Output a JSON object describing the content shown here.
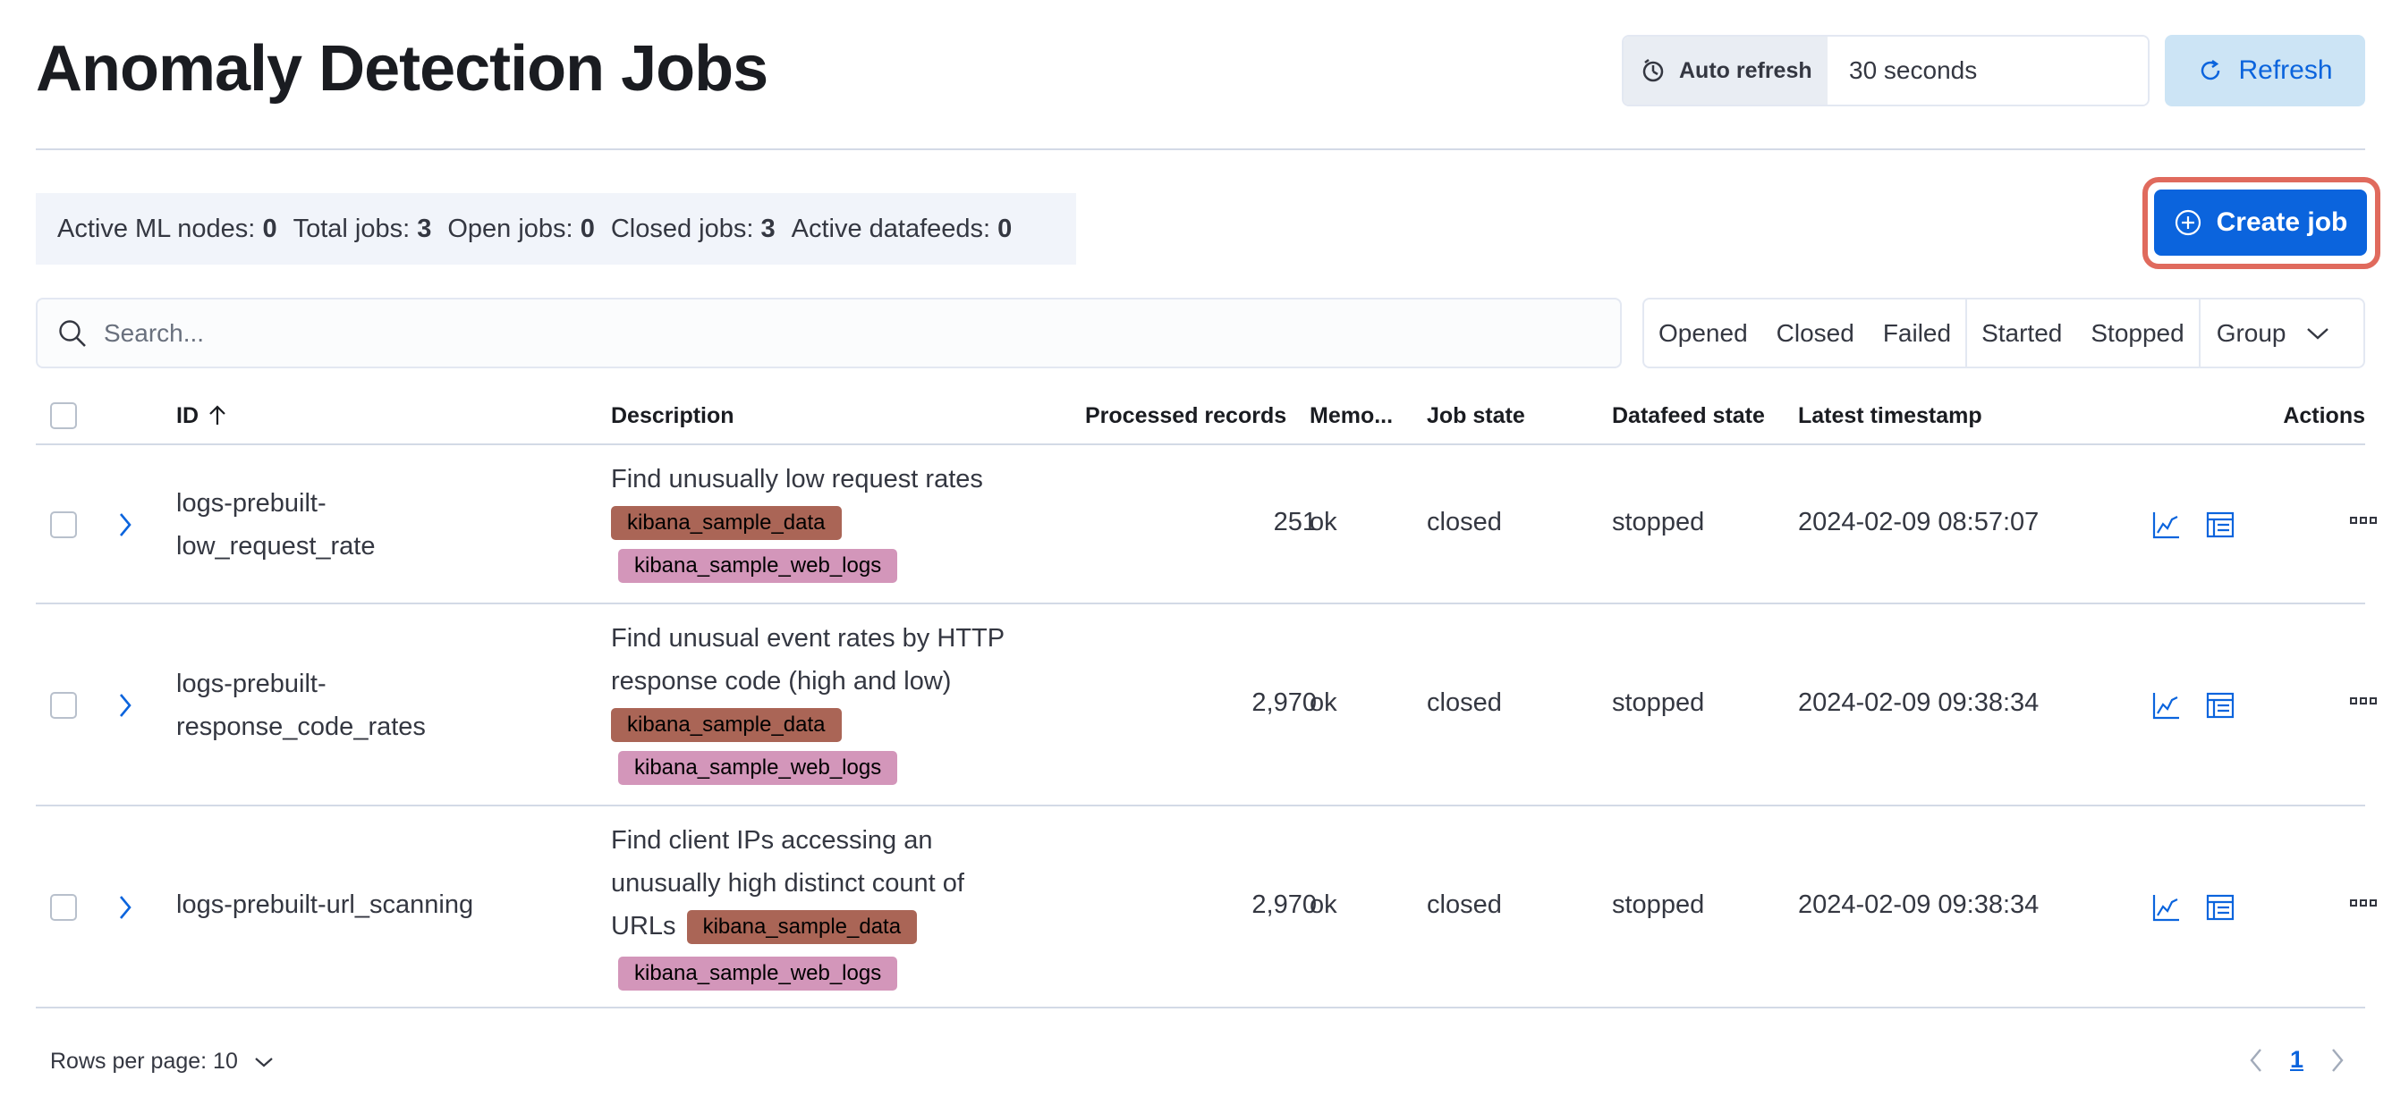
{
  "page": {
    "title": "Anomaly Detection Jobs"
  },
  "auto_refresh": {
    "label": "Auto refresh",
    "value": "30 seconds"
  },
  "refresh_button": {
    "label": "Refresh"
  },
  "stats": [
    {
      "label": "Active ML nodes:",
      "value": "0"
    },
    {
      "label": "Total jobs:",
      "value": "3"
    },
    {
      "label": "Open jobs:",
      "value": "0"
    },
    {
      "label": "Closed jobs:",
      "value": "3"
    },
    {
      "label": "Active datafeeds:",
      "value": "0"
    }
  ],
  "create_button": {
    "label": "Create job"
  },
  "search": {
    "placeholder": "Search..."
  },
  "filters": {
    "opened": "Opened",
    "closed": "Closed",
    "failed": "Failed",
    "started": "Started",
    "stopped": "Stopped",
    "group": "Group"
  },
  "table": {
    "columns": {
      "id": "ID",
      "description": "Description",
      "processed": "Processed records",
      "memory": "Memo...",
      "job_state": "Job state",
      "datafeed_state": "Datafeed state",
      "latest": "Latest timestamp",
      "actions": "Actions"
    },
    "rows": [
      {
        "id_line1": "logs-prebuilt-",
        "id_line2": "low_request_rate",
        "desc_line1": "Find unusually low request rates",
        "desc_line2": "",
        "desc_line3": "",
        "tag1": "kibana_sample_data",
        "tag2": "kibana_sample_web_logs",
        "processed": "251",
        "memory": "ok",
        "job_state": "closed",
        "datafeed_state": "stopped",
        "latest": "2024-02-09 08:57:07"
      },
      {
        "id_line1": "logs-prebuilt-",
        "id_line2": "response_code_rates",
        "desc_line1": "Find unusual event rates by HTTP",
        "desc_line2": "response code (high and low)",
        "desc_line3": "",
        "tag1": "kibana_sample_data",
        "tag2": "kibana_sample_web_logs",
        "processed": "2,970",
        "memory": "ok",
        "job_state": "closed",
        "datafeed_state": "stopped",
        "latest": "2024-02-09 09:38:34"
      },
      {
        "id_line1": "logs-prebuilt-url_scanning",
        "id_line2": "",
        "desc_line1": "Find client IPs accessing an",
        "desc_line2": "unusually high distinct count of",
        "desc_line3": "URLs",
        "tag1": "kibana_sample_data",
        "tag2": "kibana_sample_web_logs",
        "processed": "2,970",
        "memory": "ok",
        "job_state": "closed",
        "datafeed_state": "stopped",
        "latest": "2024-02-09 09:38:34"
      }
    ]
  },
  "footer": {
    "rows_per_page_label": "Rows per page: 10",
    "current_page": "1"
  },
  "colors": {
    "primary": "#0b64dd",
    "tag_dark": "#aa6556",
    "tag_light": "#d396ba",
    "highlight": "#e06a5d"
  }
}
